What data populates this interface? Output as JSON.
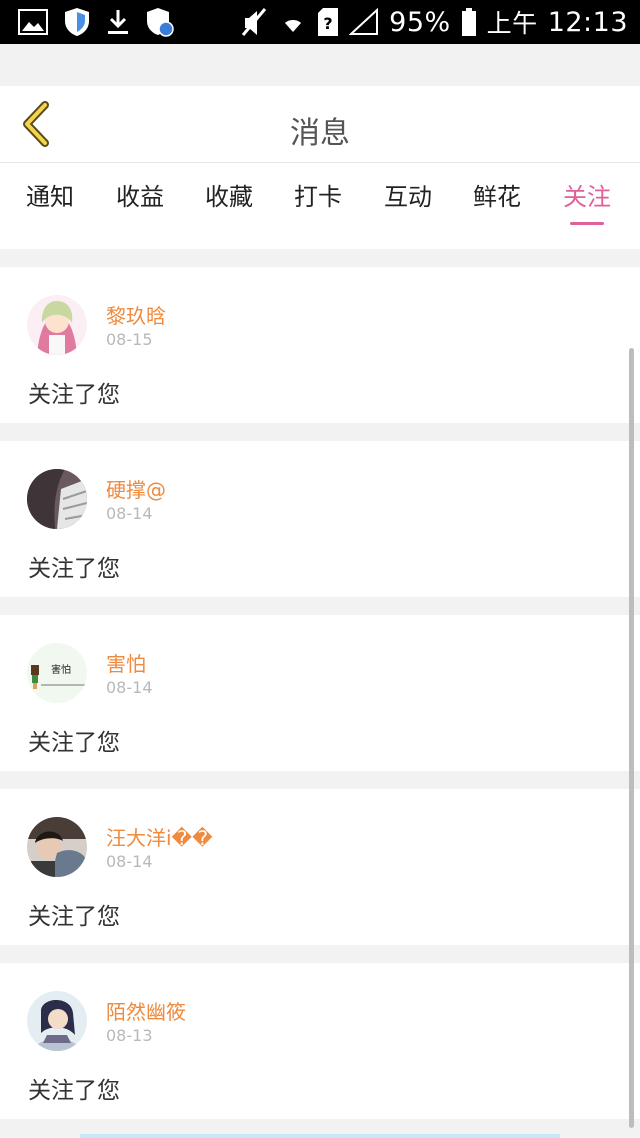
{
  "status_bar": {
    "battery": "95%",
    "ampm": "上午",
    "time": "12:13",
    "icons": [
      "image-icon",
      "shield-icon",
      "download-icon",
      "shield-badge-icon",
      "mute-icon",
      "wifi-icon",
      "sim-unknown-icon",
      "signal-icon",
      "battery-icon"
    ]
  },
  "header": {
    "title": "消息",
    "back_icon": "chevron-left-icon",
    "back_color": "#e1c84b"
  },
  "tabs": [
    {
      "label": "通知",
      "active": false
    },
    {
      "label": "收益",
      "active": false
    },
    {
      "label": "收藏",
      "active": false
    },
    {
      "label": "打卡",
      "active": false
    },
    {
      "label": "互动",
      "active": false
    },
    {
      "label": "鲜花",
      "active": false
    },
    {
      "label": "关注",
      "active": true
    }
  ],
  "accent_color": "#e0609a",
  "items": [
    {
      "name": "黎玖晗",
      "date": "08-15",
      "message": "关注了您",
      "avatar_desc": "anime-girl-avatar"
    },
    {
      "name": "硬撑@",
      "date": "08-14",
      "message": "关注了您",
      "avatar_desc": "dark-avatar"
    },
    {
      "name": "害怕",
      "date": "08-14",
      "message": "关注了您",
      "avatar_desc": "pixel-text-avatar",
      "avatar_text": "害怕"
    },
    {
      "name": "汪大洋i��",
      "date": "08-14",
      "message": "关注了您",
      "avatar_desc": "photo-avatar"
    },
    {
      "name": "陌然幽筱",
      "date": "08-13",
      "message": "关注了您",
      "avatar_desc": "anime-boy-avatar"
    }
  ]
}
